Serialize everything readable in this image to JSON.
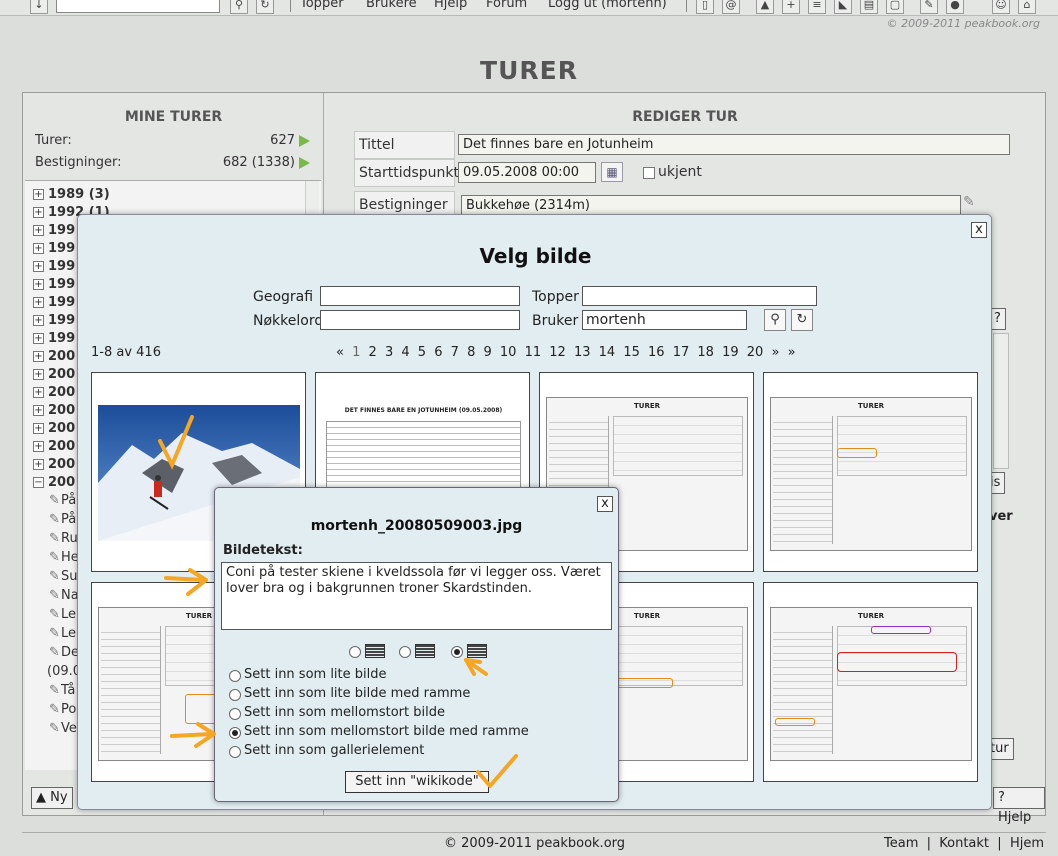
{
  "topbar": {
    "nav": [
      "Topper",
      "Brukere",
      "Hjelp",
      "Forum",
      "Logg ut (mortenh)"
    ],
    "copyright": "© 2009-2011 peakbook.org"
  },
  "page_title": "TURER",
  "left": {
    "heading": "MINE TURER",
    "turer_label": "Turer:",
    "turer_value": "627",
    "best_label": "Bestigninger:",
    "best_value": "682 (1338)",
    "years": [
      "1989 (3)",
      "1992 (1)",
      "199",
      "199",
      "199",
      "199",
      "199",
      "199",
      "199",
      "200",
      "200",
      "200",
      "200",
      "200",
      "200",
      "200",
      "200"
    ],
    "subitems": [
      "På",
      "På",
      "Ru",
      "He",
      "Su",
      "Na",
      "Le",
      "Le",
      "De",
      "(09.0",
      "Tå",
      "Po",
      "Ve"
    ],
    "new_button": "Ny"
  },
  "right": {
    "heading": "REDIGER TUR",
    "title_label": "Tittel",
    "title_value": "Det finnes bare en Jotunheim",
    "start_label": "Starttidspunkt",
    "start_value": "09.05.2008 00:00",
    "unknown_label": "ukjent",
    "best_label": "Bestigninger",
    "best_value": "Bukkehøe (2314m)",
    "help_button": "Hjelp",
    "side_text_1": "is",
    "side_text_2": "ver",
    "side_text_3": "tur",
    "q_button": "?"
  },
  "modal": {
    "title": "Velg bilde",
    "close": "x",
    "geo_label": "Geografi",
    "geo_value": "",
    "topper_label": "Topper",
    "topper_value": "",
    "keyword_label": "Nøkkelord",
    "keyword_value": "",
    "user_label": "Bruker",
    "user_value": "mortenh",
    "count": "1-8 av 416",
    "pager": [
      "«",
      "1",
      "2",
      "3",
      "4",
      "5",
      "6",
      "7",
      "8",
      "9",
      "10",
      "11",
      "12",
      "13",
      "14",
      "15",
      "16",
      "17",
      "18",
      "19",
      "20",
      "»",
      "»"
    ],
    "thumb_doc_title": "DET FINNES BARE EN JOTUNHEIM (09.05.2008)",
    "thumb_ui_title": "TURER"
  },
  "dialog": {
    "close": "x",
    "filename": "mortenh_20080509003.jpg",
    "caption_label": "Bildetekst:",
    "caption": "Coni på tester skiene i kveldssola før vi legger oss. Været lover bra og i bakgrunnen troner Skardstinden.",
    "options": [
      "Sett inn som lite bilde",
      "Sett inn som lite bilde med ramme",
      "Sett inn som mellomstort bilde",
      "Sett inn som mellomstort bilde med ramme",
      "Sett inn som gallerielement"
    ],
    "selected_option": 3,
    "insert_button": "Sett inn \"wikikode\""
  },
  "footer": {
    "copyright": "© 2009-2011 peakbook.org",
    "links": "Team  |  Kontakt  |  Hjem"
  },
  "colors": {
    "accent_green": "#7ab84a",
    "annotation_orange": "#f5a623"
  }
}
